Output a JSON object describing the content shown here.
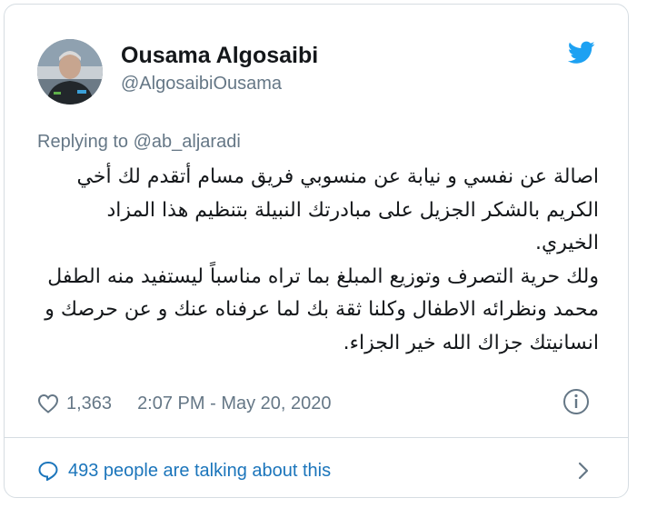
{
  "author": {
    "name": "Ousama Algosaibi",
    "handle": "@AlgosaibiOusama",
    "avatar_icon": "profile-photo"
  },
  "brand": {
    "icon": "twitter-bird-icon",
    "color": "#1da1f2"
  },
  "reply": {
    "prefix": "Replying to ",
    "target": "@ab_aljaradi"
  },
  "tweet": {
    "paragraphs": [
      "اصالة عن نفسي و نيابة عن منسوبي فريق مسام أتقدم لك أخي الكريم بالشكر الجزيل على مبادرتك النبيلة بتنظيم هذا المزاد الخيري.",
      "ولك حرية التصرف وتوزيع المبلغ بما تراه مناسباً ليستفيد منه الطفل محمد ونظرائه الاطفال وكلنا ثقة بك لما عرفناه عنك و عن حرصك و انسانيتك جزاك الله خير الجزاء."
    ]
  },
  "meta": {
    "likes": "1,363",
    "timestamp": "2:07 PM - May 20, 2020"
  },
  "footer": {
    "talking": "493 people are talking about this",
    "link_color": "#1b75bb"
  }
}
